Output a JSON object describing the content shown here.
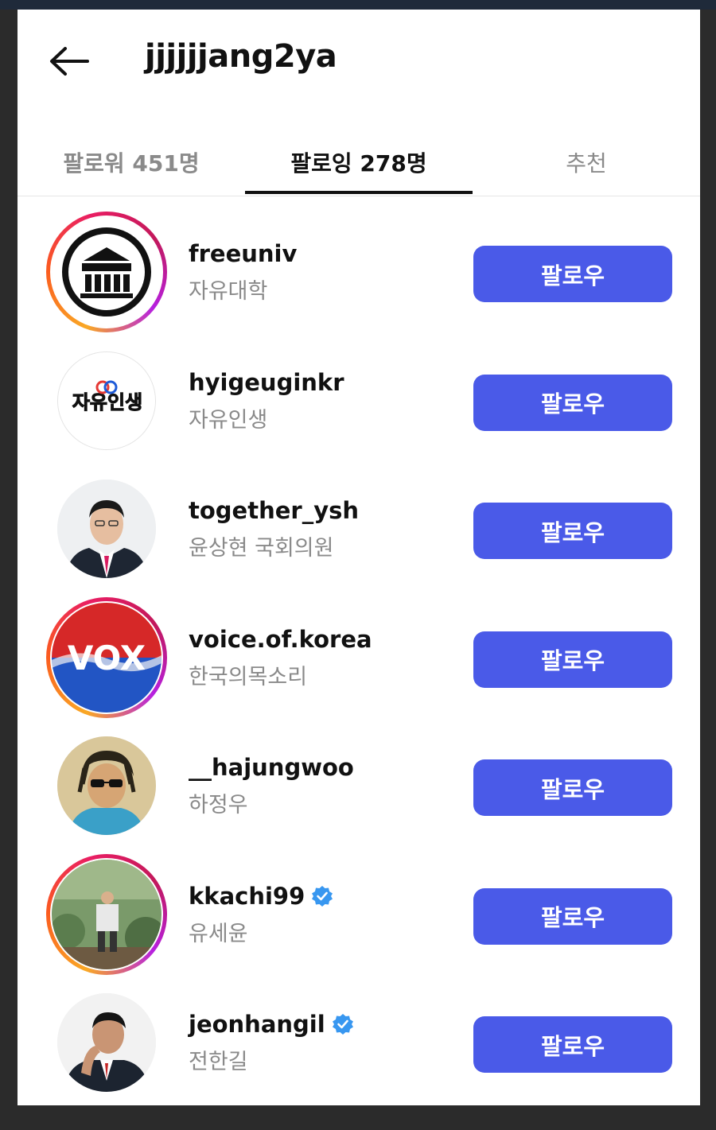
{
  "header": {
    "title": "jjjjjjang2ya"
  },
  "tabs": [
    {
      "label": "팔로워 451명",
      "active": false
    },
    {
      "label": "팔로잉 278명",
      "active": true
    },
    {
      "label": "추천",
      "active": false
    }
  ],
  "follow_label": "팔로우",
  "accent_color": "#4a5ae8",
  "users": [
    {
      "username": "freeuniv",
      "display_name": "자유대학",
      "verified": false,
      "story_ring": true,
      "avatar": "freedom-univ-logo"
    },
    {
      "username": "hyigeuginkr",
      "display_name": "자유인생",
      "verified": false,
      "story_ring": false,
      "avatar": "jayu-insaeng-logo"
    },
    {
      "username": "together_ysh",
      "display_name": "윤상현 국회의원",
      "verified": false,
      "story_ring": false,
      "avatar": "man-in-suit-photo"
    },
    {
      "username": "voice.of.korea",
      "display_name": "한국의목소리",
      "verified": false,
      "story_ring": true,
      "avatar": "vok-logo",
      "avatar_text": "VOX"
    },
    {
      "username": "__hajungwoo",
      "display_name": "하정우",
      "verified": false,
      "story_ring": false,
      "avatar": "man-sunglasses-photo"
    },
    {
      "username": "kkachi99",
      "display_name": "유세윤",
      "verified": true,
      "story_ring": true,
      "avatar": "outdoor-person-photo"
    },
    {
      "username": "jeonhangil",
      "display_name": "전한길",
      "verified": true,
      "story_ring": false,
      "avatar": "man-suit-pose-photo"
    }
  ]
}
